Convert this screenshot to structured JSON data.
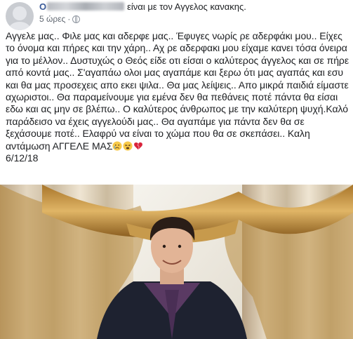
{
  "post": {
    "author_prefix": "O",
    "headline_suffix": "είναι με τον Αγγελος κανακης.",
    "time": "5 ώρες",
    "privacy_icon": "globe-icon",
    "text": "Αγγελε μας.. Φιλε μας και αδερφε μας.. Έφυγες νωρίς ρε αδερφάκι μου.. Είχες το όνομα και πήρες και την χάρη.. Αχ ρε αδερφακι μου είχαμε κανει τόσα όνειρα για το μέλλον.. Δυστυχώς ο Θεός είδε οτι είσαι ο καλύτερος άγγελος και σε πήρε από κοντά μας.. Σ'αγαπάω ολοι μας αγαπάμε και ξερω ότι μας αγαπάς και εσυ και θα μας προσεχεις απο εκει ψιλα.. Θα μας λείψεις.. Απο μικρά παιδιά είμαστε αχωριστοι.. Θα παραμείνουμε για εμένα δεν θα πεθάνεις ποτέ πάντα θα είσαι εδω και ας μην σε βλέπω.. Ο καλύτερος άνθρωπος με την καλύτερη ψυχή.Καλό παράδεισο να έχεις αγγελούδι μας.. Θα αγαπάμε για πάντα δεν θα σε ξεχάσουμε ποτέ.. Ελαφρύ να είναι το χώμα που θα σε σκεπάσει.. Καλη αντάμωση ΑΓΓΕΛΕ ΜΑΣ",
    "emojis": [
      "sad-face-icon",
      "tired-face-icon",
      "broken-heart-icon"
    ],
    "date": "6/12/18"
  },
  "colors": {
    "link": "#385898",
    "meta": "#606770",
    "text": "#1c1e21"
  }
}
